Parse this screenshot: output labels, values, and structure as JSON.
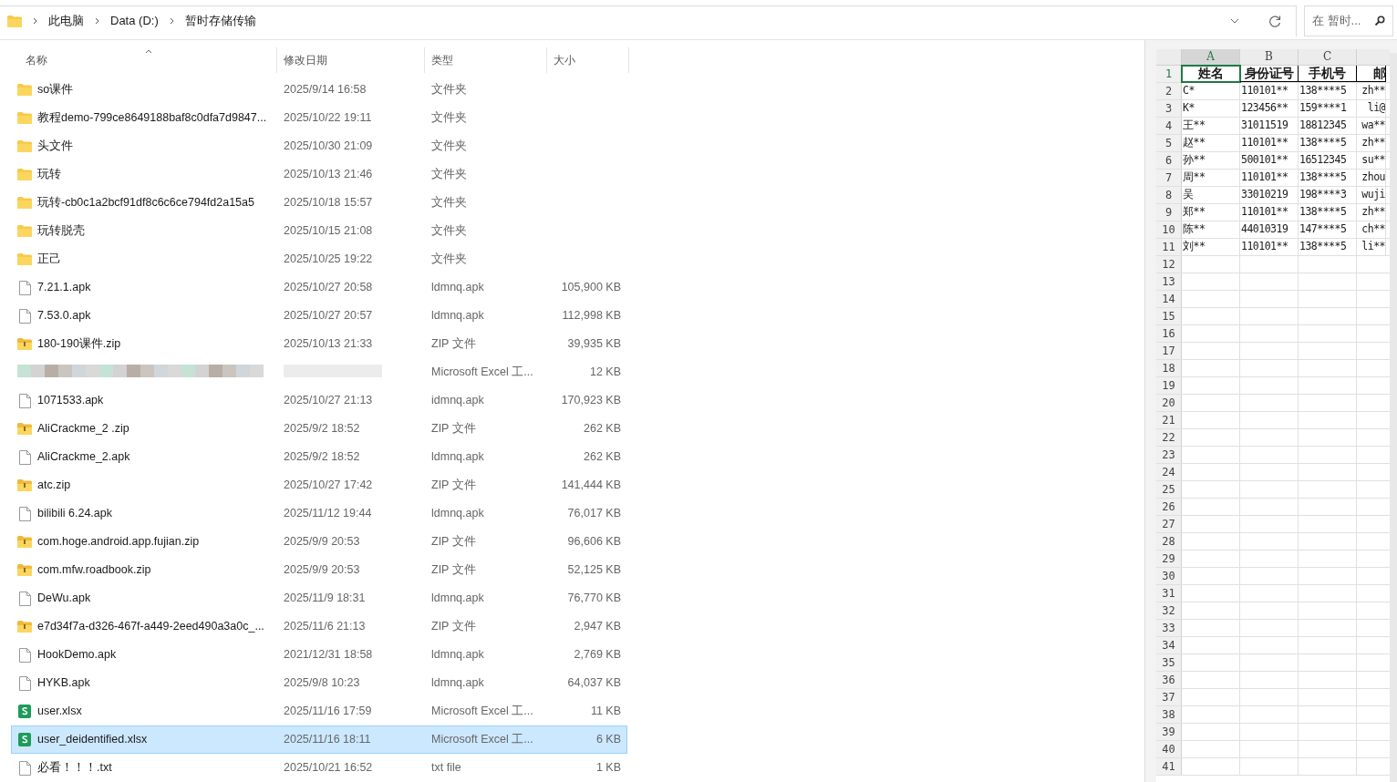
{
  "address_bar": {
    "path": [
      "此电脑",
      "Data (D:)",
      "暂时存储传输"
    ],
    "search": {
      "placeholder": "在 暂时..."
    }
  },
  "file_list": {
    "columns": [
      "名称",
      "修改日期",
      "类型",
      "大小"
    ],
    "rows": [
      {
        "kind": "folder",
        "name": "so课件",
        "modified": "2025/9/14 16:58",
        "type": "文件夹",
        "selected": false
      },
      {
        "kind": "folder",
        "name": "教程demo-799ce8649188baf8c0dfa7d9847...",
        "modified": "2025/10/22 19:11",
        "type": "文件夹",
        "selected": false
      },
      {
        "kind": "folder",
        "name": "头文件",
        "modified": "2025/10/30 21:09",
        "type": "文件夹",
        "selected": false
      },
      {
        "kind": "folder",
        "name": "玩转",
        "modified": "2025/10/13 21:46",
        "type": "文件夹",
        "selected": false
      },
      {
        "kind": "folder",
        "name": "玩转-cb0c1a2bcf91df8c6c6ce794fd2a15a5",
        "modified": "2025/10/18 15:57",
        "type": "文件夹",
        "selected": false
      },
      {
        "kind": "folder",
        "name": "玩转脱壳",
        "modified": "2025/10/15 21:08",
        "type": "文件夹",
        "selected": false
      },
      {
        "kind": "folder",
        "name": "正己",
        "modified": "2025/10/25 19:22",
        "type": "文件夹",
        "selected": false
      },
      {
        "kind": "file",
        "name": "7.21.1.apk",
        "modified": "2025/10/27 20:58",
        "type": "ldmnq.apk",
        "size": "105,900 KB",
        "selected": false
      },
      {
        "kind": "file",
        "name": "7.53.0.apk",
        "modified": "2025/10/27 20:57",
        "type": "ldmnq.apk",
        "size": "112,998 KB",
        "selected": false
      },
      {
        "kind": "zip",
        "name": "180-190课件.zip",
        "modified": "2025/10/13 21:33",
        "type": "ZIP 文件",
        "size": "39,935 KB",
        "selected": false
      },
      {
        "kind": "redacted",
        "type": "Microsoft Excel 工...",
        "size": "12 KB",
        "selected": false
      },
      {
        "kind": "file",
        "name": "1071533.apk",
        "modified": "2025/10/27 21:13",
        "type": "idmnq.apk",
        "size": "170,923 KB",
        "selected": false
      },
      {
        "kind": "zip",
        "name": "AliCrackme_2 .zip",
        "modified": "2025/9/2 18:52",
        "type": "ZIP 文件",
        "size": "262 KB",
        "selected": false
      },
      {
        "kind": "file",
        "name": "AliCrackme_2.apk",
        "modified": "2025/9/2 18:52",
        "type": "ldmnq.apk",
        "size": "262 KB",
        "selected": false
      },
      {
        "kind": "zip",
        "name": "atc.zip",
        "modified": "2025/10/27 17:42",
        "type": "ZIP 文件",
        "size": "141,444 KB",
        "selected": false
      },
      {
        "kind": "file",
        "name": "bilibili 6.24.apk",
        "modified": "2025/11/12 19:44",
        "type": "ldmnq.apk",
        "size": "76,017 KB",
        "selected": false
      },
      {
        "kind": "zip",
        "name": "com.hoge.android.app.fujian.zip",
        "modified": "2025/9/9 20:53",
        "type": "ZIP 文件",
        "size": "96,606 KB",
        "selected": false
      },
      {
        "kind": "zip",
        "name": "com.mfw.roadbook.zip",
        "modified": "2025/9/9 20:53",
        "type": "ZIP 文件",
        "size": "52,125 KB",
        "selected": false
      },
      {
        "kind": "file",
        "name": "DeWu.apk",
        "modified": "2025/11/9 18:31",
        "type": "ldmnq.apk",
        "size": "76,770 KB",
        "selected": false
      },
      {
        "kind": "zip",
        "name": "e7d34f7a-d326-467f-a449-2eed490a3a0c_...",
        "modified": "2025/11/6 21:13",
        "type": "ZIP 文件",
        "size": "2,947 KB",
        "selected": false
      },
      {
        "kind": "file",
        "name": "HookDemo.apk",
        "modified": "2021/12/31 18:58",
        "type": "ldmnq.apk",
        "size": "2,769 KB",
        "selected": false
      },
      {
        "kind": "file",
        "name": "HYKB.apk",
        "modified": "2025/9/8 10:23",
        "type": "ldmnq.apk",
        "size": "64,037 KB",
        "selected": false
      },
      {
        "kind": "excel",
        "name": "user.xlsx",
        "modified": "2025/11/16 17:59",
        "type": "Microsoft Excel 工...",
        "size": "11 KB",
        "selected": false
      },
      {
        "kind": "excel",
        "name": "user_deidentified.xlsx",
        "modified": "2025/11/16 18:11",
        "type": "Microsoft Excel 工...",
        "size": "6 KB",
        "selected": true
      },
      {
        "kind": "file",
        "name": "必看！！！.txt",
        "modified": "2025/10/21 16:52",
        "type": "txt file",
        "size": "1 KB",
        "selected": false
      }
    ]
  },
  "spreadsheet": {
    "column_letters": [
      "A",
      "B",
      "C"
    ],
    "rows": [
      {
        "number": "1",
        "cells": [
          "姓名",
          "身份证号",
          "手机号",
          "邮"
        ]
      },
      {
        "number": "2",
        "cells": [
          "C*",
          "110101**",
          "138****5",
          "zh**"
        ]
      },
      {
        "number": "3",
        "cells": [
          "K*",
          "123456**",
          "159****1",
          "li@"
        ]
      },
      {
        "number": "4",
        "cells": [
          "王**",
          "31011519",
          "18812345",
          "wa**"
        ]
      },
      {
        "number": "5",
        "cells": [
          "赵**",
          "110101**",
          "138****5",
          "zh**"
        ]
      },
      {
        "number": "6",
        "cells": [
          "孙**",
          "500101**",
          "16512345",
          "su**"
        ]
      },
      {
        "number": "7",
        "cells": [
          "周**",
          "110101**",
          "138****5",
          "zhou"
        ]
      },
      {
        "number": "8",
        "cells": [
          "吴",
          "33010219",
          "198****3",
          "wuji"
        ]
      },
      {
        "number": "9",
        "cells": [
          "郑**",
          "110101**",
          "138****5",
          "zh**"
        ]
      },
      {
        "number": "10",
        "cells": [
          "陈**",
          "44010319",
          "147****5",
          "ch**"
        ]
      },
      {
        "number": "11",
        "cells": [
          "刘**",
          "110101**",
          "138****5",
          "li**"
        ]
      }
    ],
    "empty_row_numbers": [
      "12",
      "13",
      "14",
      "15",
      "16",
      "17",
      "18",
      "19",
      "20",
      "21",
      "22",
      "23",
      "24",
      "25",
      "26",
      "27",
      "28",
      "29",
      "30",
      "31",
      "32",
      "33",
      "34",
      "35",
      "36",
      "37",
      "38",
      "39",
      "40",
      "41"
    ]
  }
}
